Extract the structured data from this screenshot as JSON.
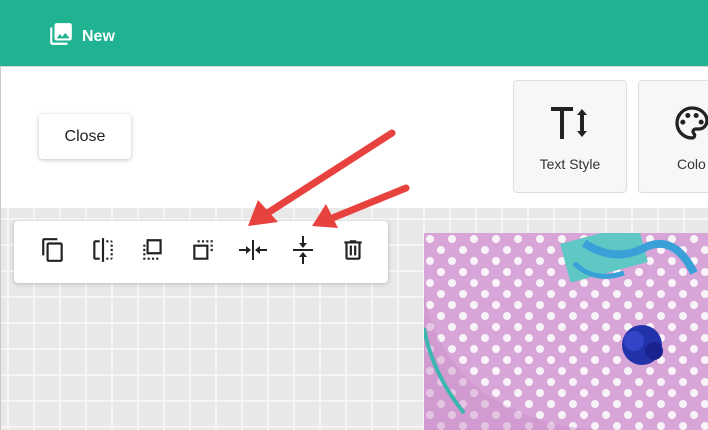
{
  "header": {
    "title": "New",
    "icon": "photo-library-icon",
    "color": "#1fb391"
  },
  "panel": {
    "close_label": "Close",
    "tools": [
      {
        "label": "Text Style",
        "icon": "text-size-icon"
      },
      {
        "label": "Colo",
        "icon": "palette-icon"
      }
    ]
  },
  "toolbar": {
    "buttons": [
      {
        "name": "duplicate-icon"
      },
      {
        "name": "flip-icon"
      },
      {
        "name": "bring-forward-icon"
      },
      {
        "name": "send-backward-icon"
      },
      {
        "name": "center-horizontal-icon"
      },
      {
        "name": "center-vertical-icon"
      },
      {
        "name": "delete-icon"
      }
    ]
  },
  "annotation": {
    "arrow_color": "#e8423f",
    "arrow_count": 2
  },
  "canvas": {
    "image": "paper-plate-photo",
    "accent": "#d9a6d6"
  }
}
